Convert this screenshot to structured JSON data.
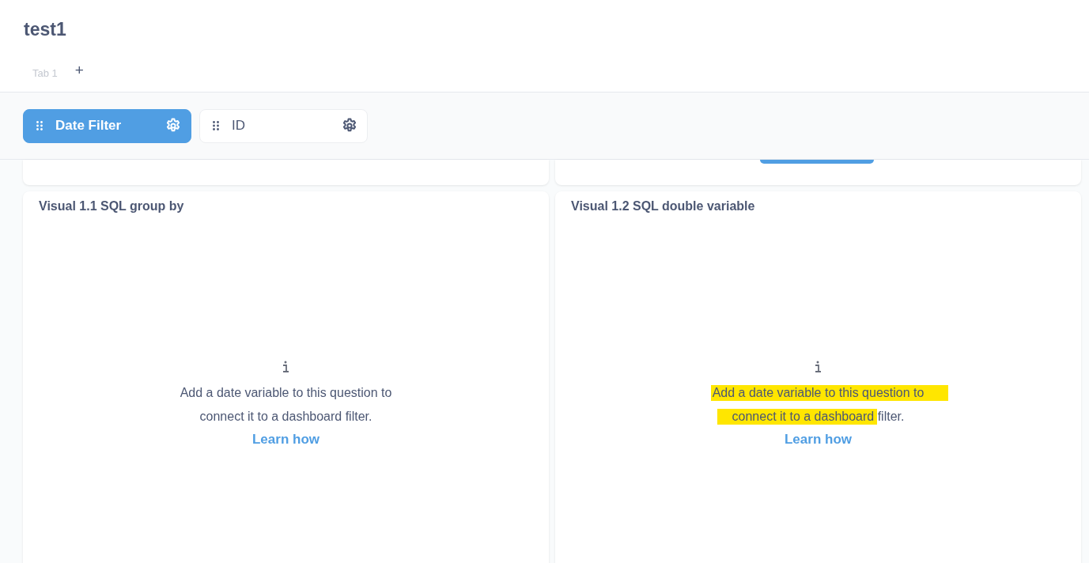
{
  "dashboard": {
    "title": "test1"
  },
  "tabs": [
    {
      "label": "Tab 1",
      "selected": false
    }
  ],
  "add_tab": "+",
  "filters": [
    {
      "label": "Date Filter",
      "selected": true
    },
    {
      "label": "ID",
      "selected": false
    }
  ],
  "partial_cards": [
    {
      "has_button": false
    },
    {
      "has_button": true
    }
  ],
  "cards": [
    {
      "title": "Visual 1.1 SQL group by",
      "message": "Add a date variable to this question to connect it to a dashboard filter.",
      "link": "Learn how",
      "highlighted": false
    },
    {
      "title": "Visual 1.2 SQL double variable",
      "message": "Add a date variable to this question to connect it to a dashboard filter.",
      "link": "Learn how",
      "highlighted": true
    }
  ]
}
